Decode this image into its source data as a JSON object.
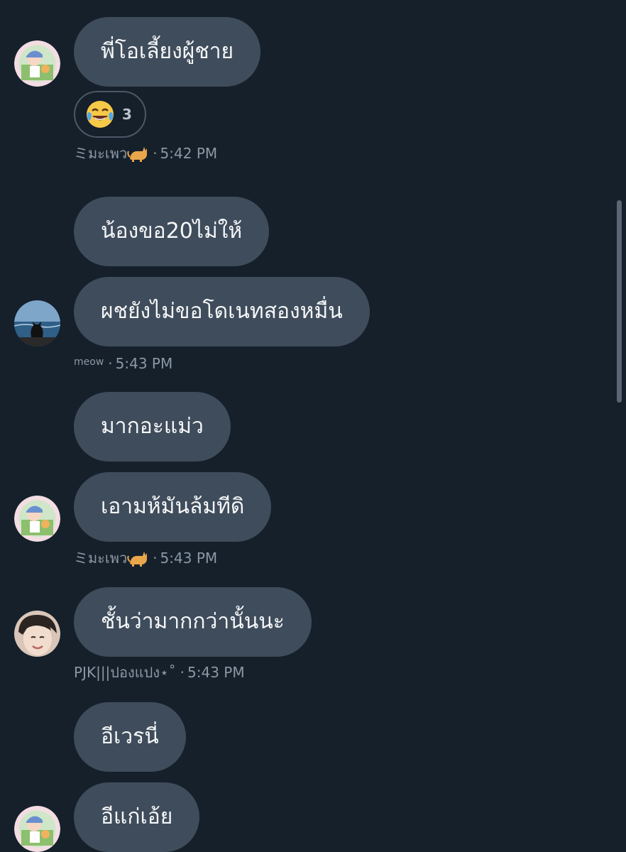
{
  "messages": [
    {
      "text": "พี่โอเลี้ยงผู้ชาย"
    },
    {
      "text": "น้องขอ20ไม่ให้"
    },
    {
      "text": "ผชยังไม่ขอโดเนทสองหมื่น"
    },
    {
      "text": "มากอะแม่ว"
    },
    {
      "text": "เอามห้มันล้มทีดิ"
    },
    {
      "text": "ชั้นว่ามากกว่านั้นนะ"
    },
    {
      "text": "อีเวรนี่"
    },
    {
      "text": "อีแก่เอ้ย"
    }
  ],
  "reaction": {
    "emoji": "face-with-tears-of-joy",
    "count": "3"
  },
  "meta": [
    {
      "sender": "ミมะเพว",
      "icon": "cat-icon",
      "separator": "·",
      "time": "5:42 PM"
    },
    {
      "sender": "meow",
      "separator": "·",
      "time": "5:43 PM"
    },
    {
      "sender": "ミมะเพว",
      "icon": "cat-icon",
      "separator": "·",
      "time": "5:43 PM"
    },
    {
      "sender": "PJK|||ปองแปง⋆˚",
      "separator": "·",
      "time": "5:43 PM"
    }
  ],
  "colors": {
    "background": "#15202b",
    "bubble": "#3f4c5b",
    "meta_text": "#8b98a5"
  }
}
